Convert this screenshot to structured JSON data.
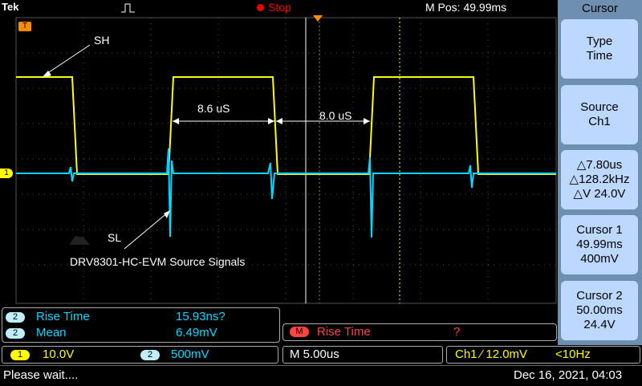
{
  "topbar": {
    "brand": "Tek",
    "run_state": "Stop",
    "m_pos": "M Pos: 49.99ms"
  },
  "channel1_marker": "1",
  "trigger_marker": "T",
  "annotations": {
    "sh_label": "SH",
    "sl_label": "SL",
    "width1": "8.6 uS",
    "width2": "8.0 uS",
    "caption": "DRV8301-HC-EVM Source Signals"
  },
  "side_menu": {
    "title": "Cursor",
    "buttons": [
      {
        "line1": "Type",
        "line2": "Time",
        "line3": ""
      },
      {
        "line1": "Source",
        "line2": "Ch1",
        "line3": ""
      },
      {
        "line1": "△7.80us",
        "line2": "△128.2kHz",
        "line3": "△V 24.0V"
      },
      {
        "line1": "Cursor 1",
        "line2": "49.99ms",
        "line3": "400mV"
      },
      {
        "line1": "Cursor 2",
        "line2": "50.00ms",
        "line3": "24.4V"
      }
    ]
  },
  "measurements": [
    {
      "channel": "2",
      "name": "Rise Time",
      "value": "15.93ns?"
    },
    {
      "channel": "2",
      "name": "Mean",
      "value": "6.49mV"
    }
  ],
  "math_measurement": {
    "channel": "M",
    "name": "Rise Time",
    "value": "?"
  },
  "bottom": {
    "ch1_label": "1",
    "ch1_scale": "10.0V",
    "ch2_label": "2",
    "ch2_scale": "500mV",
    "timebase": "M 5.00us",
    "trigger": "Ch1 ⁄ 12.0mV",
    "freq": "<10Hz"
  },
  "status": {
    "message": "Please wait....",
    "datetime": "Dec 16, 2021, 04:03"
  },
  "colors": {
    "ch1": "#ffff00",
    "ch2": "#00d8ff",
    "accent": "#ff8c00",
    "panel": "#6f8fb0",
    "button": "#bcd8ff"
  }
}
